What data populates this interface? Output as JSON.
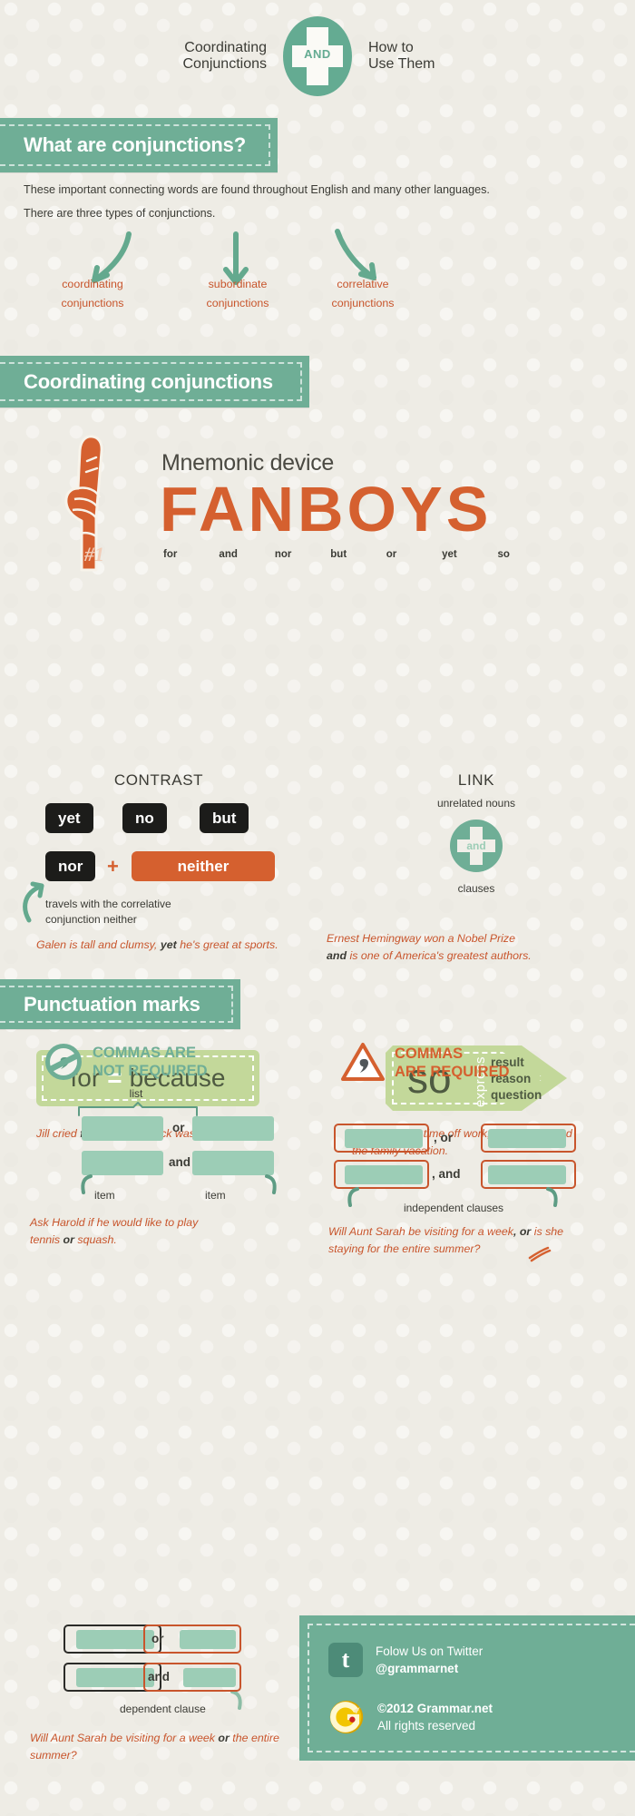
{
  "title": {
    "left_line1": "Coordinating",
    "left_line2": "Conjunctions",
    "badge_label": "AND",
    "right_line1": "How to",
    "right_line2": "Use Them"
  },
  "sections": {
    "what_are": "What are conjunctions?",
    "coordinating": "Coordinating conjunctions",
    "punctuation": "Punctuation marks"
  },
  "intro": {
    "line1": "These important connecting words are found throughout English and many other languages.",
    "line2": "There are three types of conjunctions.",
    "types": [
      {
        "word1": "coordinating",
        "word2": "conjunctions"
      },
      {
        "word1": "subordinate",
        "word2": "conjunctions"
      },
      {
        "word1": "correlative",
        "word2": "conjunctions"
      }
    ]
  },
  "fanboys": {
    "mnemonic_label": "Mnemonic device",
    "word": "FANBOYS",
    "words": [
      "for",
      "and",
      "nor",
      "but",
      "or",
      "yet",
      "so"
    ],
    "hand_number": "#1"
  },
  "contrast": {
    "heading": "CONTRAST",
    "chips_row1": [
      "yet",
      "no",
      "but"
    ],
    "chip_nor": "nor",
    "plus": "+",
    "chip_neither": "neither",
    "note_line1": "travels with the correlative",
    "note_line2": "conjunction neither",
    "example_a": "Galen is tall and clumsy,",
    "example_kw": "yet",
    "example_b": "he's great at sports."
  },
  "link": {
    "heading": "LINK",
    "top_label": "unrelated nouns",
    "badge_label": "and",
    "bottom_label": "clauses",
    "example_line1": "Ernest Hemingway won a Nobel Prize",
    "example_kw": "and",
    "example_line2": "is one of America's greatest authors."
  },
  "for_because": {
    "left": "for",
    "equals": "=",
    "right": "because",
    "example_a": "Jill cried",
    "example_kw": "for",
    "example_b": "she knew Jack was her only love."
  },
  "so_tag": {
    "word": "so",
    "express": "express",
    "keywords": [
      "result",
      "reason",
      "question"
    ],
    "example_a": "Jim can't take time off work,",
    "example_kw": "so",
    "example_b": "we canceled the family vacation."
  },
  "commas_not_required": {
    "heading_line1": "COMMAS ARE",
    "heading_line2": "NOT REQUIRED",
    "bracket_label": "list",
    "conn_or": "or",
    "conn_and": "and",
    "item_left": "item",
    "item_right": "item",
    "example_line1_a": "Ask Harold if he would like to play",
    "example_line2_a": "tennis",
    "example_kw": "or",
    "example_line2_b": "squash."
  },
  "commas_required": {
    "heading_line1": "COMMAS",
    "heading_line2": "ARE REQUIRED",
    "conn_or": ", or",
    "conn_and": ", and",
    "caption": "independent clauses",
    "example_a": "Will Aunt Sarah be visiting for a week",
    "example_kw": ", or",
    "example_b": "is she staying for the entire summer?"
  },
  "dependent_clause": {
    "conn_or": "or",
    "conn_and": "and",
    "caption": "dependent clause",
    "example_a": "Will Aunt Sarah be visiting for a week",
    "example_kw": "or",
    "example_b": "the entire summer?"
  },
  "footer": {
    "twitter_line1": "Folow Us on Twitter",
    "twitter_handle": "@grammarnet",
    "copyright": "©2012 Grammar.net",
    "rights": "All rights reserved"
  },
  "colors": {
    "background": "#eeece5",
    "teal": "#6fae96",
    "orange": "#d5602f",
    "orange_text": "#c8552c",
    "dark": "#3b3b35",
    "light_green": "#c3d89a",
    "blank_green": "#9ccdb6"
  }
}
